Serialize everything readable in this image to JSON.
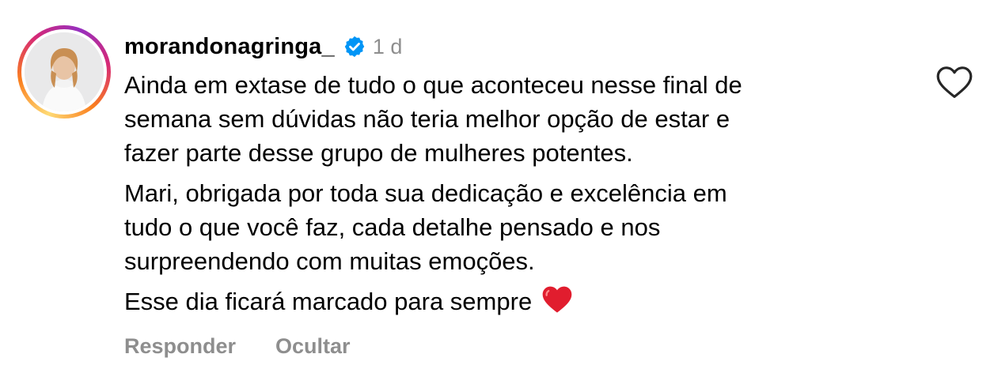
{
  "comment": {
    "username": "morandonagringa_",
    "time": "1 d",
    "paragraphs": [
      "Ainda em extase de tudo o que aconteceu nesse final de\nsemana sem dúvidas não teria melhor opção de estar e\nfazer parte desse grupo de mulheres potentes.",
      "Mari, obrigada por toda sua dedicação e excelência em\ntudo o que você faz, cada detalhe pensado e nos\nsurpreendendo com muitas emoções.",
      "Esse dia ficará marcado para sempre"
    ],
    "trailing_emoji": "red-heart-emoji",
    "actions": {
      "reply": "Responder",
      "hide": "Ocultar"
    }
  },
  "icons": {
    "verified": "verified-badge-icon",
    "like": "heart-outline-icon"
  },
  "colors": {
    "verified_blue": "#0095f6",
    "muted_text": "#8e8e8e",
    "heart_red": "#e0245e"
  }
}
